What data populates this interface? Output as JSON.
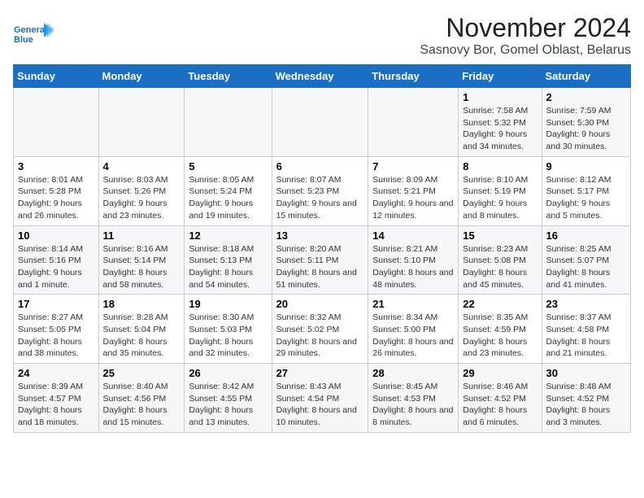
{
  "logo": {
    "line1": "General",
    "line2": "Blue"
  },
  "title": "November 2024",
  "subtitle": "Sasnovy Bor, Gomel Oblast, Belarus",
  "weekdays": [
    "Sunday",
    "Monday",
    "Tuesday",
    "Wednesday",
    "Thursday",
    "Friday",
    "Saturday"
  ],
  "weeks": [
    [
      {
        "day": "",
        "info": ""
      },
      {
        "day": "",
        "info": ""
      },
      {
        "day": "",
        "info": ""
      },
      {
        "day": "",
        "info": ""
      },
      {
        "day": "",
        "info": ""
      },
      {
        "day": "1",
        "info": "Sunrise: 7:58 AM\nSunset: 5:32 PM\nDaylight: 9 hours and 34 minutes."
      },
      {
        "day": "2",
        "info": "Sunrise: 7:59 AM\nSunset: 5:30 PM\nDaylight: 9 hours and 30 minutes."
      }
    ],
    [
      {
        "day": "3",
        "info": "Sunrise: 8:01 AM\nSunset: 5:28 PM\nDaylight: 9 hours and 26 minutes."
      },
      {
        "day": "4",
        "info": "Sunrise: 8:03 AM\nSunset: 5:26 PM\nDaylight: 9 hours and 23 minutes."
      },
      {
        "day": "5",
        "info": "Sunrise: 8:05 AM\nSunset: 5:24 PM\nDaylight: 9 hours and 19 minutes."
      },
      {
        "day": "6",
        "info": "Sunrise: 8:07 AM\nSunset: 5:23 PM\nDaylight: 9 hours and 15 minutes."
      },
      {
        "day": "7",
        "info": "Sunrise: 8:09 AM\nSunset: 5:21 PM\nDaylight: 9 hours and 12 minutes."
      },
      {
        "day": "8",
        "info": "Sunrise: 8:10 AM\nSunset: 5:19 PM\nDaylight: 9 hours and 8 minutes."
      },
      {
        "day": "9",
        "info": "Sunrise: 8:12 AM\nSunset: 5:17 PM\nDaylight: 9 hours and 5 minutes."
      }
    ],
    [
      {
        "day": "10",
        "info": "Sunrise: 8:14 AM\nSunset: 5:16 PM\nDaylight: 9 hours and 1 minute."
      },
      {
        "day": "11",
        "info": "Sunrise: 8:16 AM\nSunset: 5:14 PM\nDaylight: 8 hours and 58 minutes."
      },
      {
        "day": "12",
        "info": "Sunrise: 8:18 AM\nSunset: 5:13 PM\nDaylight: 8 hours and 54 minutes."
      },
      {
        "day": "13",
        "info": "Sunrise: 8:20 AM\nSunset: 5:11 PM\nDaylight: 8 hours and 51 minutes."
      },
      {
        "day": "14",
        "info": "Sunrise: 8:21 AM\nSunset: 5:10 PM\nDaylight: 8 hours and 48 minutes."
      },
      {
        "day": "15",
        "info": "Sunrise: 8:23 AM\nSunset: 5:08 PM\nDaylight: 8 hours and 45 minutes."
      },
      {
        "day": "16",
        "info": "Sunrise: 8:25 AM\nSunset: 5:07 PM\nDaylight: 8 hours and 41 minutes."
      }
    ],
    [
      {
        "day": "17",
        "info": "Sunrise: 8:27 AM\nSunset: 5:05 PM\nDaylight: 8 hours and 38 minutes."
      },
      {
        "day": "18",
        "info": "Sunrise: 8:28 AM\nSunset: 5:04 PM\nDaylight: 8 hours and 35 minutes."
      },
      {
        "day": "19",
        "info": "Sunrise: 8:30 AM\nSunset: 5:03 PM\nDaylight: 8 hours and 32 minutes."
      },
      {
        "day": "20",
        "info": "Sunrise: 8:32 AM\nSunset: 5:02 PM\nDaylight: 8 hours and 29 minutes."
      },
      {
        "day": "21",
        "info": "Sunrise: 8:34 AM\nSunset: 5:00 PM\nDaylight: 8 hours and 26 minutes."
      },
      {
        "day": "22",
        "info": "Sunrise: 8:35 AM\nSunset: 4:59 PM\nDaylight: 8 hours and 23 minutes."
      },
      {
        "day": "23",
        "info": "Sunrise: 8:37 AM\nSunset: 4:58 PM\nDaylight: 8 hours and 21 minutes."
      }
    ],
    [
      {
        "day": "24",
        "info": "Sunrise: 8:39 AM\nSunset: 4:57 PM\nDaylight: 8 hours and 18 minutes."
      },
      {
        "day": "25",
        "info": "Sunrise: 8:40 AM\nSunset: 4:56 PM\nDaylight: 8 hours and 15 minutes."
      },
      {
        "day": "26",
        "info": "Sunrise: 8:42 AM\nSunset: 4:55 PM\nDaylight: 8 hours and 13 minutes."
      },
      {
        "day": "27",
        "info": "Sunrise: 8:43 AM\nSunset: 4:54 PM\nDaylight: 8 hours and 10 minutes."
      },
      {
        "day": "28",
        "info": "Sunrise: 8:45 AM\nSunset: 4:53 PM\nDaylight: 8 hours and 8 minutes."
      },
      {
        "day": "29",
        "info": "Sunrise: 8:46 AM\nSunset: 4:52 PM\nDaylight: 8 hours and 6 minutes."
      },
      {
        "day": "30",
        "info": "Sunrise: 8:48 AM\nSunset: 4:52 PM\nDaylight: 8 hours and 3 minutes."
      }
    ]
  ]
}
